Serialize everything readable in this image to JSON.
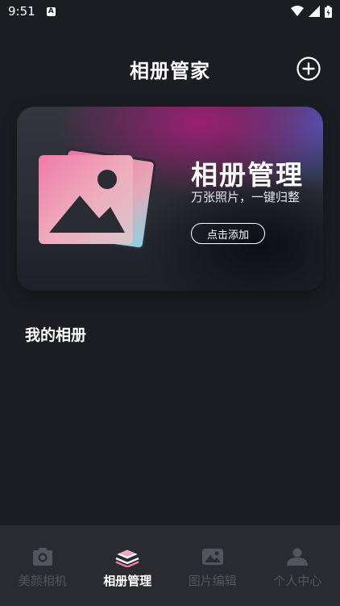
{
  "status_bar": {
    "time": "9:51",
    "notification_icon": "A",
    "icons": [
      "wifi-icon",
      "signal-icon",
      "battery-charging-icon"
    ]
  },
  "header": {
    "title": "相册管家",
    "add_icon": "plus-circle-icon"
  },
  "banner": {
    "title": "相册管理",
    "subtitle": "万张照片，一键归整",
    "button_label": "点击添加",
    "art_icon": "photo-stack-icon",
    "colors": {
      "magenta": "#a01e78",
      "blue": "#465abe",
      "photo_pink": "#f07aa8",
      "photo_cyan": "#86d2e0"
    }
  },
  "section": {
    "title": "我的相册"
  },
  "bottom_nav": {
    "active_index": 1,
    "items": [
      {
        "label": "美颜相机",
        "icon": "camera-icon"
      },
      {
        "label": "相册管理",
        "icon": "layers-icon"
      },
      {
        "label": "图片编辑",
        "icon": "image-edit-icon"
      },
      {
        "label": "个人中心",
        "icon": "user-icon"
      }
    ]
  }
}
